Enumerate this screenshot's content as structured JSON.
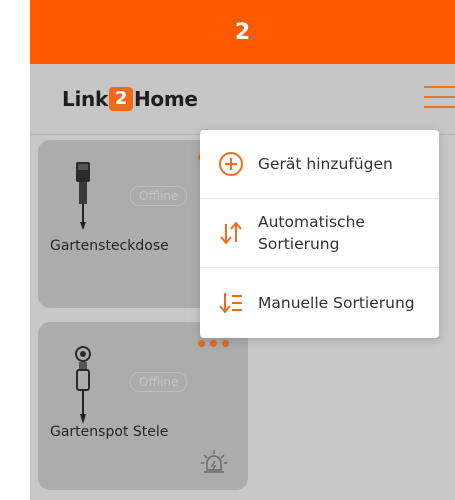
{
  "step": {
    "number": "2"
  },
  "header": {
    "logo_left": "Link",
    "logo_mark": "2",
    "logo_right": "Home"
  },
  "devices": [
    {
      "name": "Gartensteckdose",
      "status": "Offline"
    },
    {
      "name": "Gartenspot Stele",
      "status": "Offline"
    }
  ],
  "menu": {
    "items": [
      {
        "label": "Gerät hinzufügen",
        "icon": "plus-circle-icon"
      },
      {
        "label_line1": "Automatische",
        "label_line2": "Sortierung",
        "icon": "auto-sort-icon"
      },
      {
        "label": "Manuelle Sortierung",
        "icon": "manual-sort-icon"
      }
    ]
  },
  "colors": {
    "accent": "#ff5a00",
    "overlay": "#c8c8c8",
    "card": "#acacac"
  }
}
